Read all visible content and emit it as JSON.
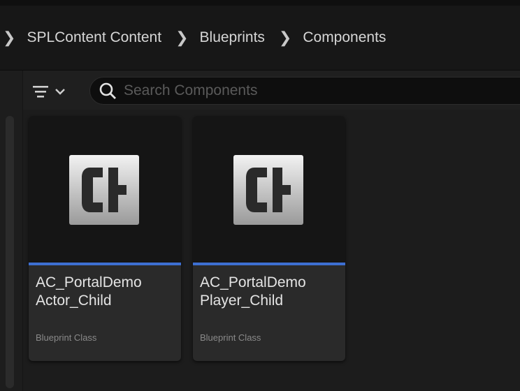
{
  "breadcrumb": {
    "items": [
      "SPLContent Content",
      "Blueprints",
      "Components"
    ]
  },
  "search": {
    "placeholder": "Search Components",
    "value": ""
  },
  "icons": {
    "breadcrumb_separator": "chevron-right-icon",
    "filter": "filter-icon",
    "filter_dropdown": "chevron-down-icon",
    "search": "search-icon",
    "asset_thumbnail": "actor-component-icon"
  },
  "assets": [
    {
      "name": "AC_PortalDemo\nActor_Child",
      "type": "Blueprint Class"
    },
    {
      "name": "AC_PortalDemo\nPlayer_Child",
      "type": "Blueprint Class"
    }
  ],
  "colors": {
    "asset_type_bar": "#3d6fd1",
    "background": "#1b1b1b",
    "search_field": "#0e0e0e"
  }
}
